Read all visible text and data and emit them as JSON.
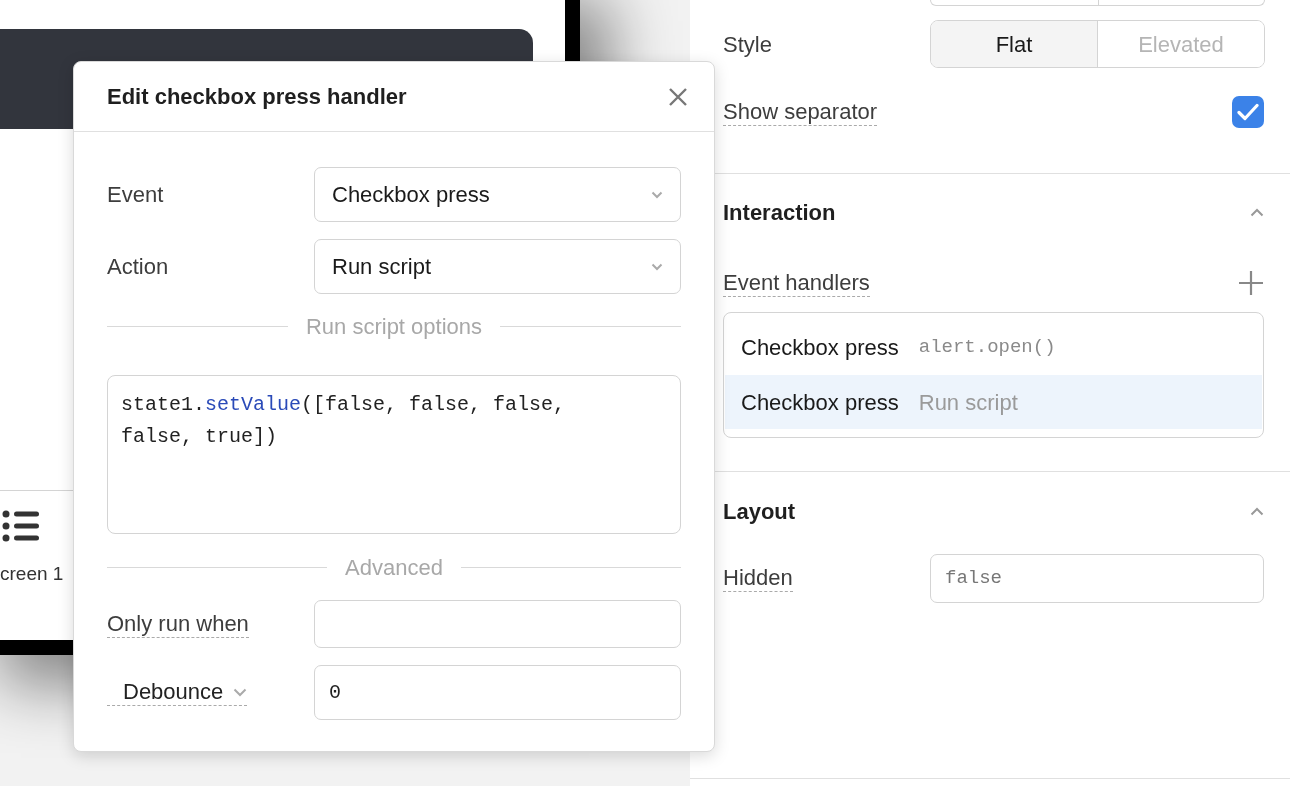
{
  "canvas": {
    "screen_tab_label": "creen 1"
  },
  "inspector": {
    "style": {
      "label": "Style",
      "options": [
        {
          "label": "Flat",
          "selected": true
        },
        {
          "label": "Elevated",
          "selected": false
        }
      ]
    },
    "show_separator": {
      "label": "Show separator",
      "checked": true
    },
    "interaction": {
      "title": "Interaction",
      "expanded": true,
      "event_handlers_label": "Event handlers",
      "handlers": [
        {
          "event": "Checkbox press",
          "action": "alert.open()",
          "kind": "code",
          "selected": false
        },
        {
          "event": "Checkbox press",
          "action": "Run script",
          "kind": "text",
          "selected": true
        }
      ]
    },
    "layout": {
      "title": "Layout",
      "expanded": true,
      "hidden": {
        "label": "Hidden",
        "value": "false"
      }
    }
  },
  "modal": {
    "title": "Edit checkbox press handler",
    "fields": [
      {
        "label": "Event",
        "value": "Checkbox press"
      },
      {
        "label": "Action",
        "value": "Run script"
      }
    ],
    "options_heading": "Run script options",
    "code_tokens": [
      {
        "text": "state1.",
        "kind": "plain"
      },
      {
        "text": "setValue",
        "kind": "method"
      },
      {
        "text": "([false, false, false, false, true])",
        "kind": "plain"
      }
    ],
    "advanced_heading": "Advanced",
    "only_run_when": {
      "label": "Only run when"
    },
    "debounce": {
      "label": "Debounce",
      "value": "0"
    }
  }
}
